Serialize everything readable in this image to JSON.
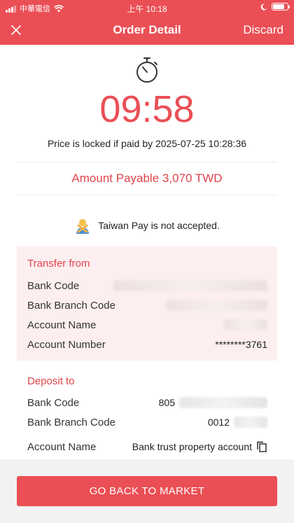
{
  "status_bar": {
    "carrier": "中華電信",
    "time": "上午 10:18"
  },
  "nav": {
    "title": "Order Detail",
    "discard": "Discard"
  },
  "timer": {
    "countdown": "09:58",
    "lock_note": "Price is locked if paid by 2025-07-25 10:28:36"
  },
  "amount_payable": "Amount Payable 3,070 TWD",
  "notice": {
    "text": "Taiwan Pay is not accepted."
  },
  "transfer_from": {
    "title": "Transfer from",
    "labels": {
      "bank_code": "Bank Code",
      "branch_code": "Bank Branch Code",
      "account_name": "Account Name",
      "account_number": "Account Number"
    },
    "account_number": "********3761"
  },
  "deposit_to": {
    "title": "Deposit to",
    "labels": {
      "bank_code": "Bank Code",
      "branch_code": "Bank Branch Code",
      "account_name": "Account Name"
    },
    "bank_code": "805",
    "branch_code": "0012",
    "account_name": "Bank trust property account"
  },
  "footer": {
    "button": "GO BACK TO MARKET"
  },
  "colors": {
    "brand": "#ea4f55",
    "card_bg": "#fdeff0",
    "footer_bg": "#f2f2f2"
  }
}
